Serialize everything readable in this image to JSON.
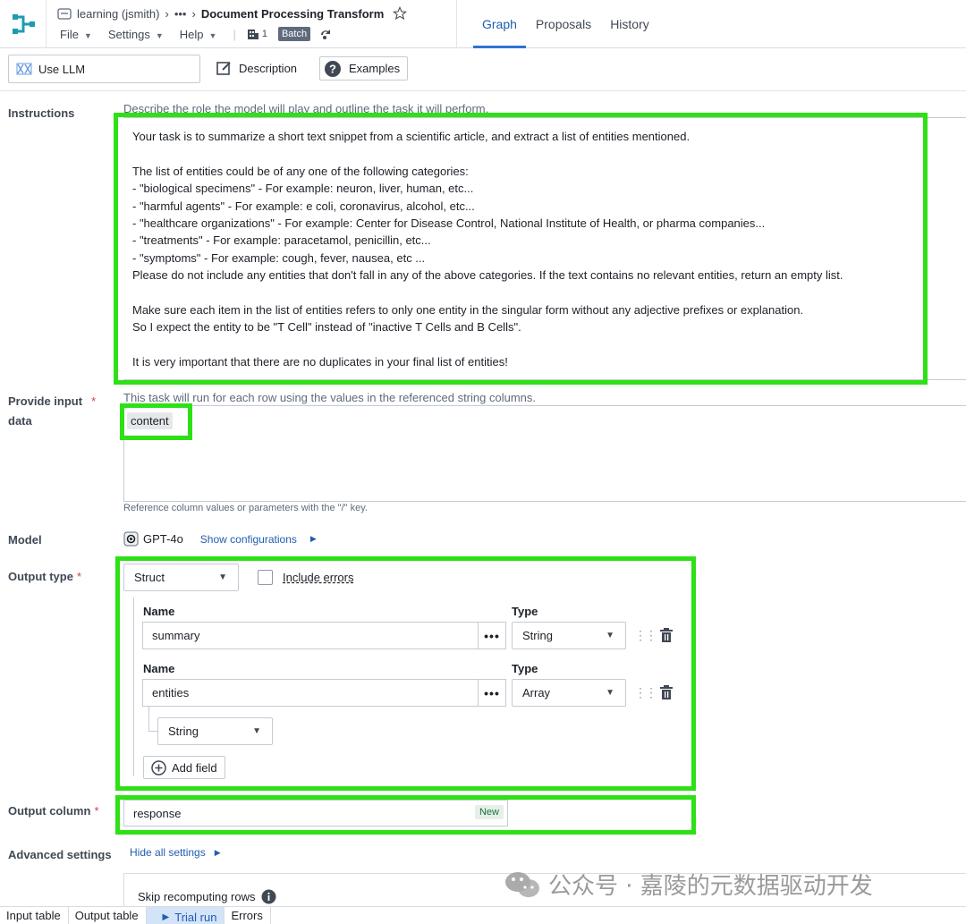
{
  "header": {
    "breadcrumb_project": "learning (jsmith)",
    "breadcrumb_more": "•••",
    "title": "Document Processing Transform",
    "menu": {
      "file": "File",
      "settings": "Settings",
      "help": "Help"
    },
    "build_count": "1",
    "batch_badge": "Batch",
    "tabs": [
      {
        "label": "Graph",
        "active": true
      },
      {
        "label": "Proposals"
      },
      {
        "label": "History"
      }
    ]
  },
  "toolbar": {
    "use_llm": "Use LLM",
    "description": "Description",
    "examples": "Examples"
  },
  "instructions": {
    "label": "Instructions",
    "placeholder": "Describe the role the model will play and outline the task it will perform.",
    "text": "Your task is to summarize a short text snippet from a scientific article, and extract a list of entities mentioned.\n\nThe list of entities could be of any one of the following categories:\n- \"biological specimens\" - For example: neuron, liver, human, etc...\n- \"harmful agents\" - For example: e coli, coronavirus, alcohol, etc...\n- \"healthcare organizations\" - For example: Center for Disease Control, National Institute of Health, or pharma companies...\n- \"treatments\" - For example: paracetamol, penicillin, etc...\n- \"symptoms\" - For example: cough, fever, nausea, etc ...\nPlease do not include any entities that don't fall in any of the above categories. If the text contains no relevant entities, return an empty list.\n\nMake sure each item in the list of entities refers to only one entity in the singular form without any adjective prefixes or explanation.\nSo I expect the entity to be \"T Cell\" instead of \"inactive T Cells and B Cells\".\n\nIt is very important that there are no duplicates in your final list of entities!"
  },
  "input_data": {
    "label_line1": "Provide input",
    "label_line2": "data",
    "required": "*",
    "hint": "This task will run for each row using the values in the referenced string columns.",
    "chip": "content",
    "footer_hint": "Reference column values or parameters with the \"/\" key."
  },
  "model": {
    "label": "Model",
    "name": "GPT-4o",
    "show_config": "Show configurations"
  },
  "output_type": {
    "label": "Output type",
    "required": "*",
    "selected": "Struct",
    "include_errors": "Include errors",
    "name_header": "Name",
    "type_header": "Type",
    "more": "•••",
    "fields": [
      {
        "name": "summary",
        "type": "String"
      },
      {
        "name": "entities",
        "type": "Array",
        "item_type": "String"
      }
    ],
    "add_field": "Add field"
  },
  "output_column": {
    "label": "Output column",
    "required": "*",
    "value": "response",
    "badge": "New"
  },
  "advanced": {
    "label": "Advanced settings",
    "toggle": "Hide all settings",
    "skip_label": "Skip recomputing rows"
  },
  "bottom_tabs": [
    {
      "label": "Input table"
    },
    {
      "label": "Output table"
    },
    {
      "label": "Trial run",
      "active": true
    },
    {
      "label": "Errors"
    }
  ],
  "watermark": "公众号 · 嘉陵的元数据驱动开发",
  "colors": {
    "accent": "#2d72d2",
    "highlight": "#2ee016",
    "required": "#cd4246"
  }
}
